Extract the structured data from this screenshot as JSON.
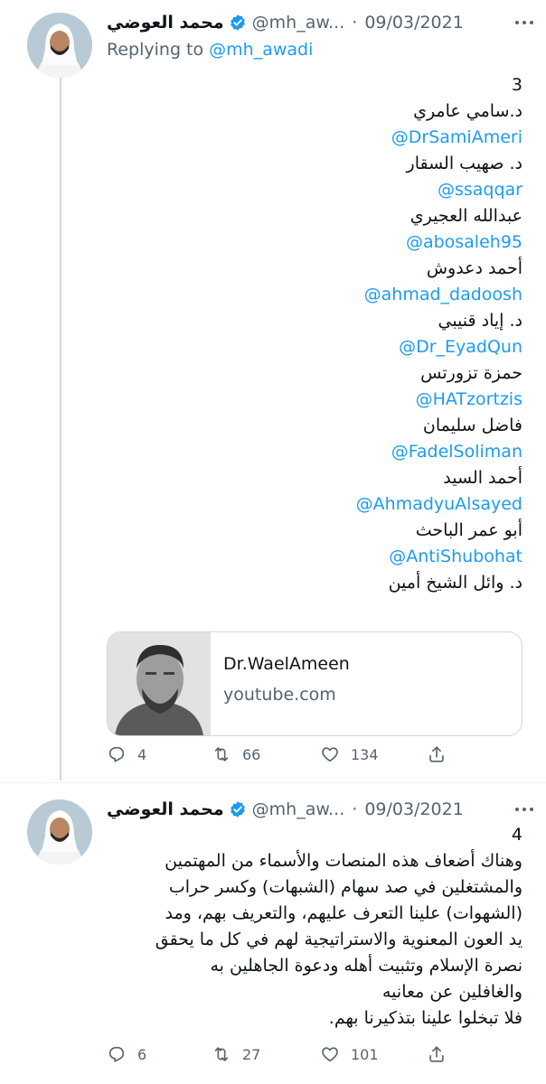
{
  "tweets": [
    {
      "author_name": "محمد العوضي",
      "handle": "@mh_aw...",
      "date": "09/03/2021",
      "replying_prefix": "Replying to",
      "replying_to": "@mh_awadi",
      "lines": [
        {
          "text": "3",
          "kind": "num"
        },
        {
          "text": "د.سامي عامري",
          "kind": "text"
        },
        {
          "text": "@DrSamiAmeri",
          "kind": "link"
        },
        {
          "text": "د. صهيب السقار",
          "kind": "text"
        },
        {
          "text": "@ssaqqar",
          "kind": "link"
        },
        {
          "text": "عبدالله العجيري",
          "kind": "text"
        },
        {
          "text": "@abosaleh95",
          "kind": "link"
        },
        {
          "text": "أحمد دعدوش",
          "kind": "text"
        },
        {
          "text": "@ahmad_dadoosh",
          "kind": "link"
        },
        {
          "text": "د. إياد قنيبي",
          "kind": "text"
        },
        {
          "text": "@Dr_EyadQun",
          "kind": "link"
        },
        {
          "text": "حمزة تزورتس",
          "kind": "text"
        },
        {
          "text": "@HATzortzis",
          "kind": "link"
        },
        {
          "text": "فاضل سليمان",
          "kind": "text"
        },
        {
          "text": "@FadelSoliman",
          "kind": "link"
        },
        {
          "text": "أحمد السيد",
          "kind": "text"
        },
        {
          "text": "@AhmadyuAlsayed",
          "kind": "link"
        },
        {
          "text": "أبو عمر الباحث",
          "kind": "text"
        },
        {
          "text": "@AntiShubohat",
          "kind": "link"
        },
        {
          "text": "د. وائل الشيخ أمين",
          "kind": "text"
        }
      ],
      "card": {
        "title": "Dr.WaelAmeen",
        "domain": "youtube.com"
      },
      "stats": {
        "replies": "4",
        "retweets": "66",
        "likes": "134"
      }
    },
    {
      "author_name": "محمد العوضي",
      "handle": "@mh_aw...",
      "date": "09/03/2021",
      "lines": [
        {
          "text": "4",
          "kind": "num"
        },
        {
          "text": "وهناك أضعاف هذه المنصات والأسماء من المهتمين",
          "kind": "text"
        },
        {
          "text": "والمشتغلين في صد سهام (الشبهات) وكسر حراب",
          "kind": "text"
        },
        {
          "text": "(الشهوات) علينا التعرف عليهم، والتعريف بهم، ومد",
          "kind": "text"
        },
        {
          "text": "يد العون المعنوية والاستراتيجية لهم في كل ما يحقق",
          "kind": "text"
        },
        {
          "text": "نصرة الإسلام وتثبيت أهله ودعوة الجاهلين به",
          "kind": "text"
        },
        {
          "text": "والغافلين عن معانيه",
          "kind": "text"
        },
        {
          "text": "فلا تبخلوا علينا بتذكيرنا بهم.",
          "kind": "text"
        }
      ],
      "stats": {
        "replies": "6",
        "retweets": "27",
        "likes": "101"
      }
    }
  ],
  "colors": {
    "link": "#1d9bf0",
    "muted": "#536471",
    "text": "#0f1419",
    "verified": "#1d9bf0"
  },
  "icons": [
    "verified-badge-icon",
    "more-icon",
    "reply-icon",
    "retweet-icon",
    "like-icon",
    "share-icon"
  ]
}
